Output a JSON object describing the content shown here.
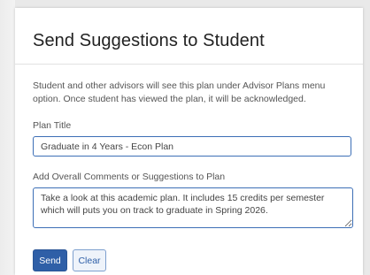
{
  "dialog": {
    "title": "Send Suggestions to Student",
    "description": "Student and other advisors will see this plan under Advisor Plans menu option. Once student has viewed the plan, it will be acknowledged."
  },
  "form": {
    "plan_title_label": "Plan Title",
    "plan_title_value": "Graduate in 4 Years - Econ Plan",
    "comments_label": "Add Overall Comments or Suggestions to Plan",
    "comments_value": "Take a look at this academic plan. It includes 15 credits per semester which will puts you on track to graduate in Spring 2026."
  },
  "actions": {
    "send_label": "Send",
    "clear_label": "Clear"
  },
  "colors": {
    "primary": "#2f5fa7",
    "input_border": "#3d6fb6"
  }
}
